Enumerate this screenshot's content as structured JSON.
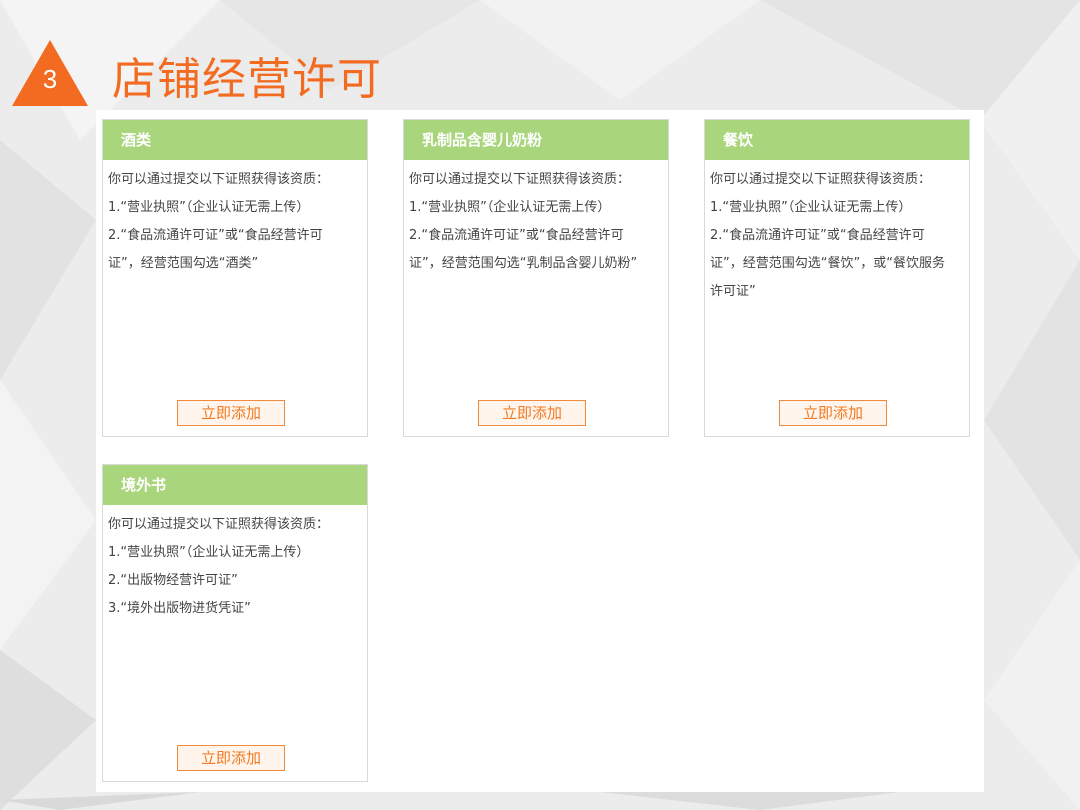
{
  "header": {
    "step_number": "3",
    "title": "店铺经营许可"
  },
  "colors": {
    "accent": "#f26b21",
    "card_header": "#a9d57c",
    "button_border": "#f08a3c"
  },
  "cards": [
    {
      "title": "酒类",
      "lines": [
        "你可以通过提交以下证照获得该资质：",
        "1.“营业执照”（企业认证无需上传）",
        "2.“食品流通许可证”或“食品经营许可",
        "证”，经营范围勾选“酒类”"
      ],
      "button": "立即添加"
    },
    {
      "title": "乳制品含婴儿奶粉",
      "lines": [
        "你可以通过提交以下证照获得该资质：",
        "1.“营业执照”（企业认证无需上传）",
        "2.“食品流通许可证”或“食品经营许可",
        "证”，经营范围勾选“乳制品含婴儿奶粉”"
      ],
      "button": "立即添加"
    },
    {
      "title": "餐饮",
      "lines": [
        "你可以通过提交以下证照获得该资质：",
        "1.“营业执照”（企业认证无需上传）",
        "2.“食品流通许可证”或“食品经营许可",
        "证”，经营范围勾选“餐饮”，或“餐饮服务",
        "许可证”"
      ],
      "button": "立即添加"
    },
    {
      "title": "境外书",
      "lines": [
        "你可以通过提交以下证照获得该资质：",
        "1.“营业执照”（企业认证无需上传）",
        "2.“出版物经营许可证”",
        "3.“境外出版物进货凭证”"
      ],
      "button": "立即添加"
    }
  ]
}
